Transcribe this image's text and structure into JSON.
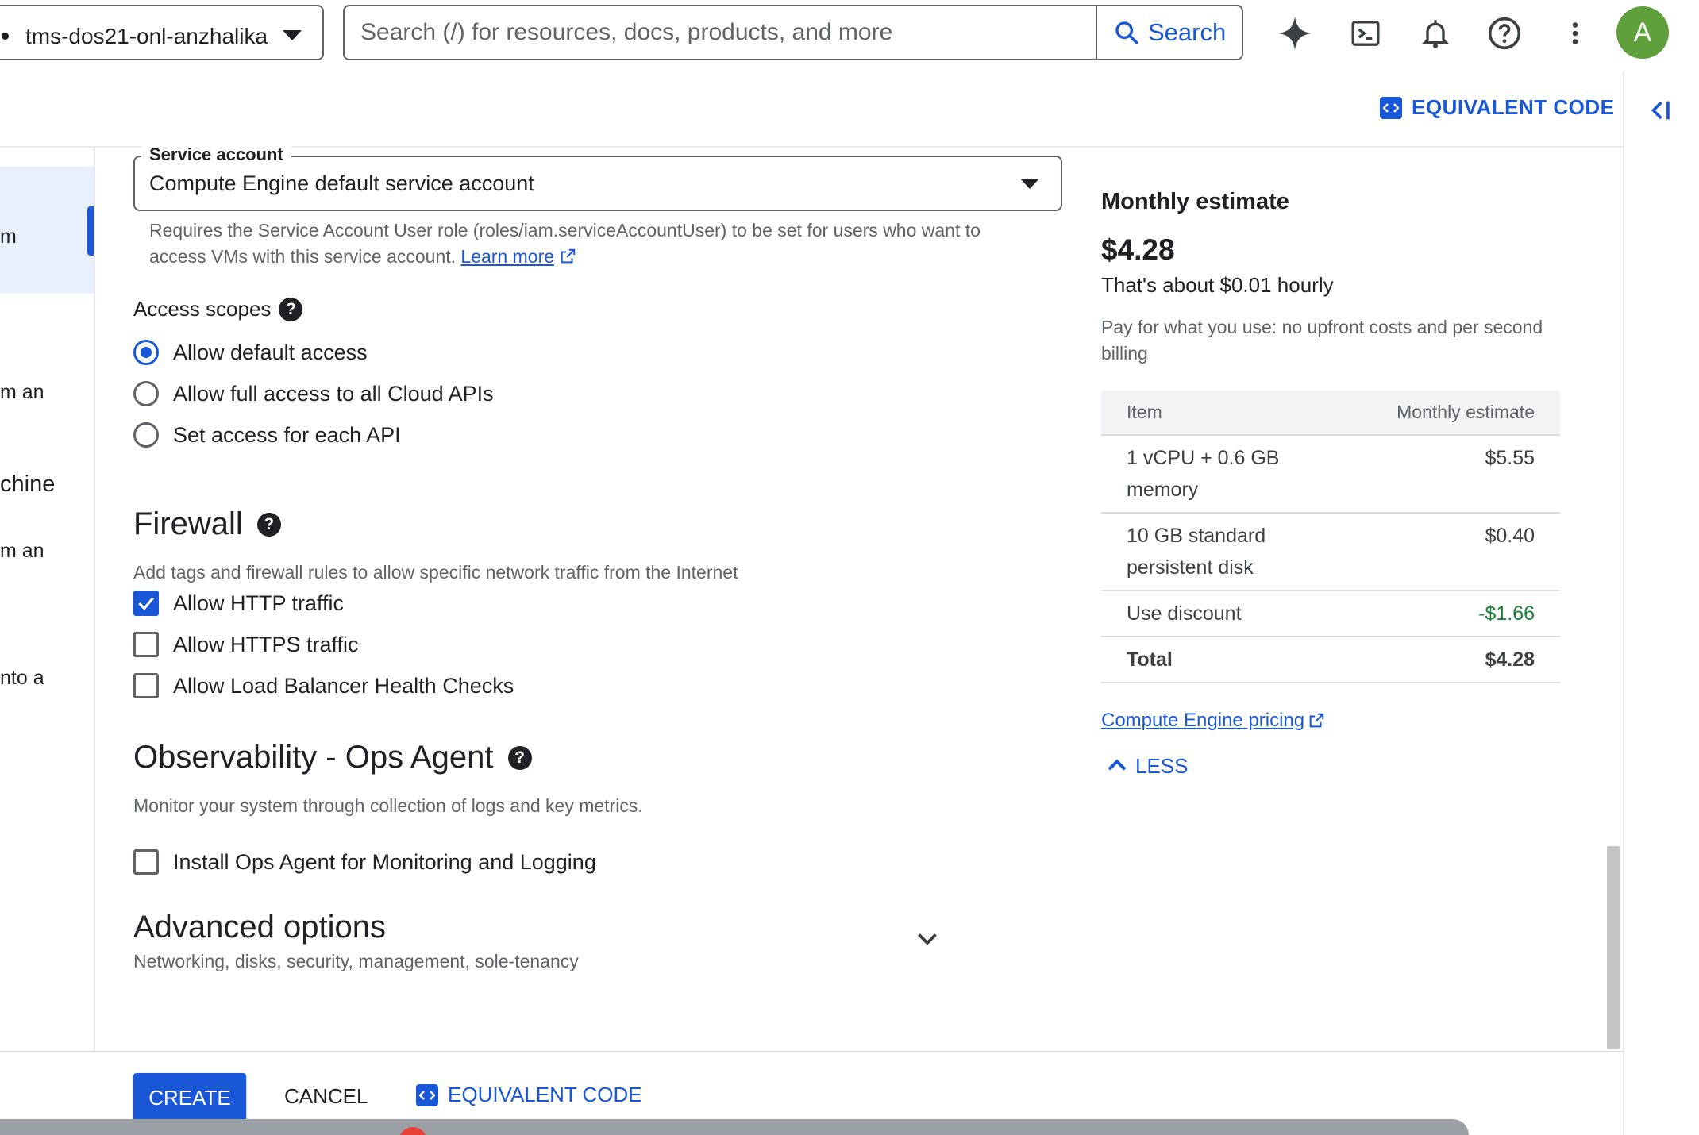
{
  "topbar": {
    "project_name": "tms-dos21-onl-anzhalika",
    "search_placeholder": "Search (/) for resources, docs, products, and more",
    "search_button": "Search",
    "icons": [
      "gemini-icon",
      "cloud-shell-icon",
      "notifications-icon",
      "help-icon",
      "more-vert-icon"
    ],
    "avatar_letter": "A"
  },
  "header": {
    "equivalent_code": "EQUIVALENT CODE"
  },
  "left_nav": {
    "fragments": [
      "m",
      "m an",
      "chine",
      "m an",
      "nto a"
    ]
  },
  "service_account": {
    "legend": "Service account",
    "value": "Compute Engine default service account",
    "help_text": "Requires the Service Account User role (roles/iam.serviceAccountUser) to be set for users who want to access VMs with this service account.",
    "learn_more": "Learn more"
  },
  "access_scopes": {
    "title": "Access scopes",
    "options": [
      {
        "label": "Allow default access",
        "selected": true
      },
      {
        "label": "Allow full access to all Cloud APIs",
        "selected": false
      },
      {
        "label": "Set access for each API",
        "selected": false
      }
    ]
  },
  "firewall": {
    "title": "Firewall",
    "description": "Add tags and firewall rules to allow specific network traffic from the Internet",
    "options": [
      {
        "label": "Allow HTTP traffic",
        "checked": true
      },
      {
        "label": "Allow HTTPS traffic",
        "checked": false
      },
      {
        "label": "Allow Load Balancer Health Checks",
        "checked": false
      }
    ]
  },
  "observability": {
    "title": "Observability - Ops Agent",
    "description": "Monitor your system through collection of logs and key metrics.",
    "option": {
      "label": "Install Ops Agent for Monitoring and Logging",
      "checked": false
    }
  },
  "advanced": {
    "title": "Advanced options",
    "description": "Networking, disks, security, management, sole-tenancy"
  },
  "estimate": {
    "title": "Monthly estimate",
    "price": "$4.28",
    "hourly": "That's about $0.01 hourly",
    "note": "Pay for what you use: no upfront costs and per second billing",
    "columns": [
      "Item",
      "Monthly estimate"
    ],
    "rows": [
      {
        "item": "1 vCPU + 0.6 GB memory",
        "cost": "$5.55"
      },
      {
        "item": "10 GB standard persistent disk",
        "cost": "$0.40"
      },
      {
        "item": "Use discount",
        "cost": "-$1.66"
      }
    ],
    "total_label": "Total",
    "total_value": "$4.28",
    "pricing_link": "Compute Engine pricing",
    "less_button": "LESS"
  },
  "bottom": {
    "create": "CREATE",
    "cancel": "CANCEL",
    "equivalent_code": "EQUIVALENT CODE"
  },
  "colors": {
    "accent": "#1a57d6",
    "discount": "#188038",
    "avatar": "#5f9f3c"
  }
}
